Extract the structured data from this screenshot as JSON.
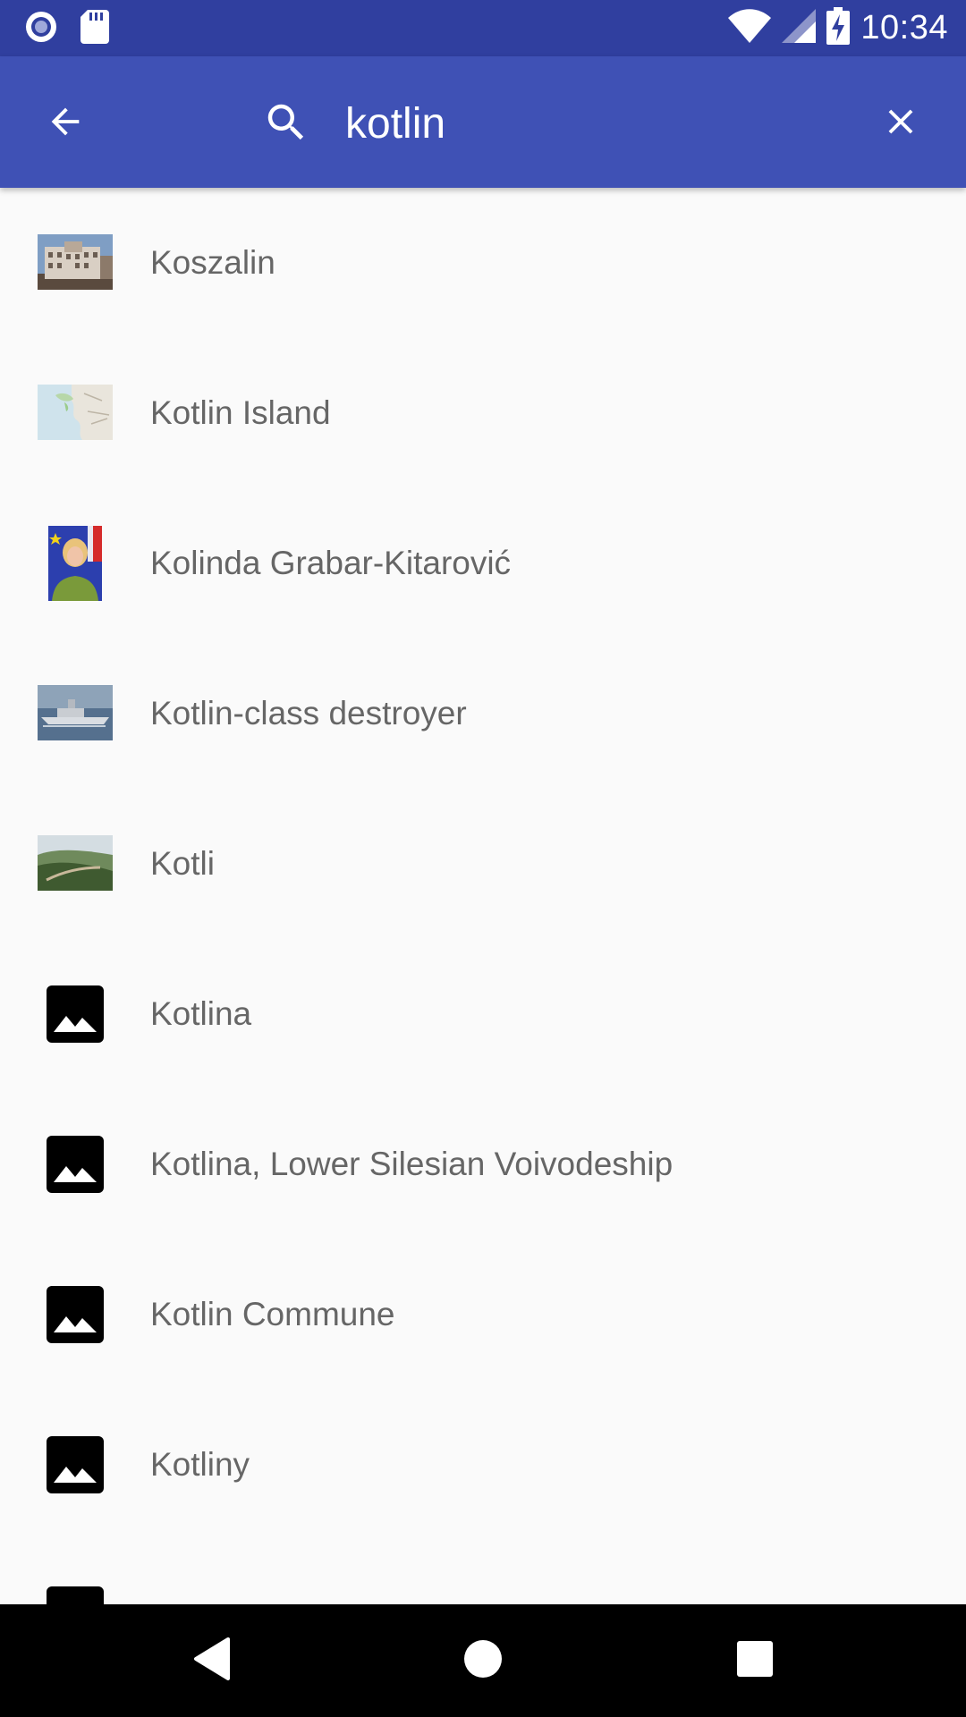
{
  "status_bar": {
    "time": "10:34",
    "icons": [
      "notification-dot-icon",
      "sd-card-icon",
      "wifi-icon",
      "cell-signal-icon",
      "battery-charging-icon"
    ]
  },
  "search": {
    "query": "kotlin",
    "back_icon": "arrow-back-icon",
    "search_icon": "search-icon",
    "clear_icon": "close-icon"
  },
  "results": [
    {
      "title": "Koszalin",
      "thumb": "photo-building"
    },
    {
      "title": "Kotlin Island",
      "thumb": "photo-map"
    },
    {
      "title": "Kolinda Grabar-Kitarović",
      "thumb": "photo-person"
    },
    {
      "title": "Kotlin-class destroyer",
      "thumb": "photo-ship"
    },
    {
      "title": "Kotli",
      "thumb": "photo-landscape"
    },
    {
      "title": "Kotlina",
      "thumb": "image-placeholder-icon"
    },
    {
      "title": "Kotlina, Lower Silesian Voivodeship",
      "thumb": "image-placeholder-icon"
    },
    {
      "title": "Kotlin Commune",
      "thumb": "image-placeholder-icon"
    },
    {
      "title": "Kotliny",
      "thumb": "image-placeholder-icon"
    },
    {
      "title": "",
      "thumb": "image-placeholder-icon"
    }
  ],
  "colors": {
    "status_bar": "#303f9f",
    "app_bar": "#3f51b5",
    "background": "#fafafa",
    "text": "#666666"
  }
}
